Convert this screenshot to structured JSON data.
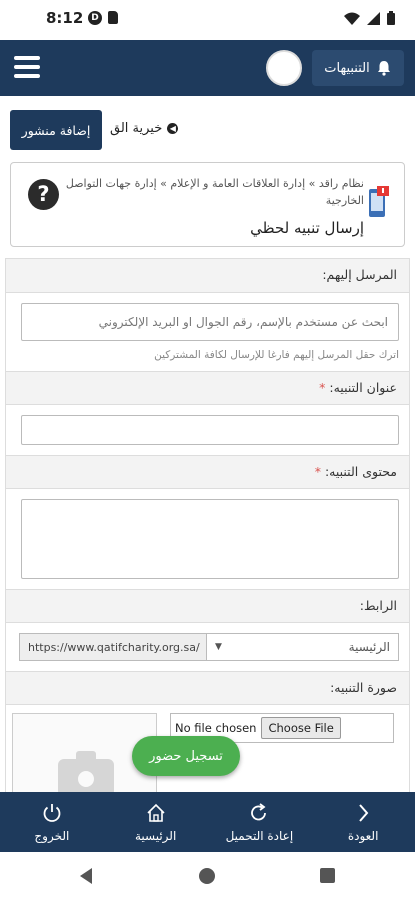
{
  "status_bar": {
    "time": "8:12"
  },
  "app_bar": {
    "notifications_label": "التنبيهات"
  },
  "post_bar": {
    "add_post_label": "إضافة منشور",
    "title_partial": "خيرية الق"
  },
  "breadcrumb": {
    "text": "نظام راقد » إدارة العلاقات العامة و الإعلام » إدارة جهات التواصل الخارجية",
    "page_title": "إرسال تنبيه لحظي"
  },
  "form": {
    "recipients": {
      "label": "المرسل إليهم:",
      "placeholder": "ابحث عن مستخدم بالإسم، رقم الجوال او البريد الإلكتروني",
      "help": "اترك حقل المرسل إليهم فارغا للإرسال لكافة المشتركين"
    },
    "title_field": {
      "label": "عنوان التنبيه:",
      "required": "*"
    },
    "content_field": {
      "label": "محتوى التنبيه:",
      "required": "*"
    },
    "link": {
      "label": "الرابط:",
      "url": "https://www.qatifcharity.org.sa/",
      "selected_page": "الرئيسية"
    },
    "image": {
      "label": "صورة التنبيه:",
      "choose_file": "Choose File",
      "no_file": "No file chosen"
    }
  },
  "fab": {
    "label": "تسجيل حضور"
  },
  "bottom_nav": {
    "back": "العودة",
    "reload": "إعادة التحميل",
    "home": "الرئيسية",
    "logout": "الخروج"
  },
  "colors": {
    "primary": "#1e3a5c",
    "accent_green": "#4caf50",
    "required_red": "#d9534f"
  }
}
